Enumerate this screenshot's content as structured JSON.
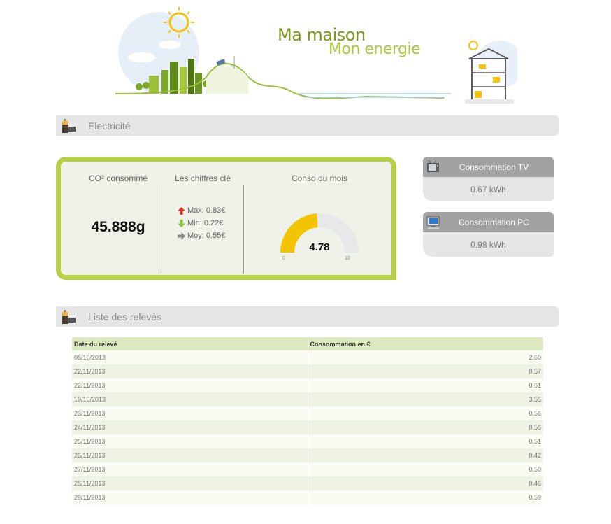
{
  "brand": {
    "line1": "Ma maison",
    "line2": "Mon energie"
  },
  "sections": {
    "electricity": "Electricité",
    "readings": "Liste des relevés"
  },
  "stats": {
    "co2_title": "CO² consommé",
    "co2_value": "45.888g",
    "keys_title": "Les chiffres clé",
    "max": "Max: 0.83€",
    "min": "Min: 0.22€",
    "avg": "Moy: 0.55€",
    "month_title": "Conso du mois",
    "gauge": {
      "value": 4.78,
      "value_text": "4.78",
      "min": 0,
      "max": 10,
      "min_label": "0",
      "max_label": "10"
    }
  },
  "widgets": [
    {
      "title": "Consommation TV",
      "value": "0.67 kWh",
      "icon": "tv-icon"
    },
    {
      "title": "Consommation PC",
      "value": "0.98 kWh",
      "icon": "computer-icon"
    }
  ],
  "table": {
    "headers": [
      "Date du relevé",
      "Consommation en €"
    ],
    "rows": [
      [
        "08/10/2013",
        "2.60"
      ],
      [
        "22/11/2013",
        "0.57"
      ],
      [
        "22/11/2013",
        "0.61"
      ],
      [
        "19/10/2013",
        "3.55"
      ],
      [
        "23/11/2013",
        "0.56"
      ],
      [
        "24/11/2013",
        "0.56"
      ],
      [
        "25/11/2013",
        "0.51"
      ],
      [
        "26/11/2013",
        "0.42"
      ],
      [
        "27/11/2013",
        "0.50"
      ],
      [
        "28/11/2013",
        "0.46"
      ],
      [
        "29/11/2013",
        "0.59"
      ]
    ]
  },
  "colors": {
    "accent_green": "#b7d146",
    "gauge_fill": "#f2c500",
    "arrow_up": "#d9342b",
    "arrow_down": "#8cc63f",
    "arrow_neutral": "#888888"
  }
}
